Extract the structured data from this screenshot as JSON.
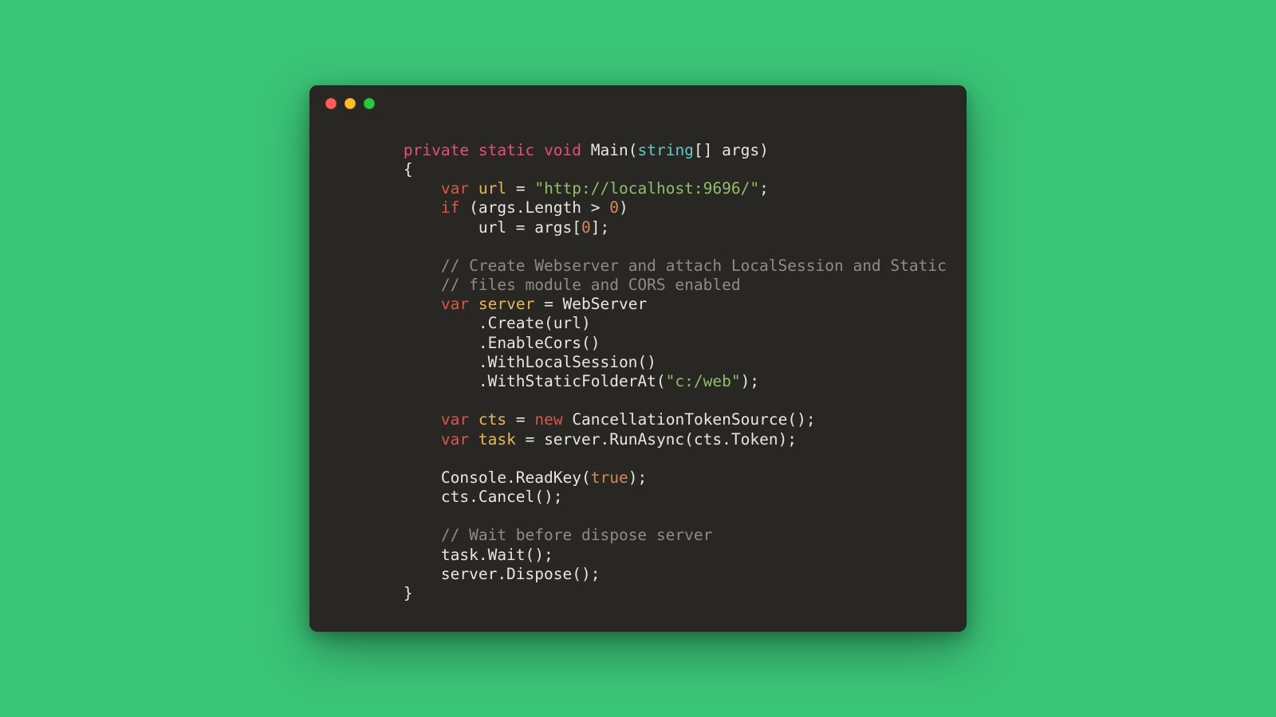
{
  "colors": {
    "background": "#3ac477",
    "window_bg": "#292724",
    "text": "#e8e6e1",
    "modifier": "#e64d80",
    "type": "#62c6c4",
    "decl": "#d9574b",
    "identifier": "#e7b85b",
    "string": "#8fbf6b",
    "number": "#d28a5a",
    "boolean": "#d28a5a",
    "comment": "#8f8c85",
    "traffic_close": "#ff5f56",
    "traffic_min": "#ffbd2e",
    "traffic_max": "#27c93f"
  },
  "window": {
    "traffic_lights": [
      "close",
      "minimize",
      "maximize"
    ]
  },
  "code": {
    "language": "csharp",
    "indent": "    ",
    "tokens": [
      [
        [
          "plain",
          "        "
        ],
        [
          "mod",
          "private"
        ],
        [
          "plain",
          " "
        ],
        [
          "mod",
          "static"
        ],
        [
          "plain",
          " "
        ],
        [
          "mod",
          "void"
        ],
        [
          "plain",
          " Main("
        ],
        [
          "type",
          "string"
        ],
        [
          "plain",
          "[] args)"
        ]
      ],
      [
        [
          "plain",
          "        {"
        ]
      ],
      [
        [
          "plain",
          "            "
        ],
        [
          "decl",
          "var"
        ],
        [
          "plain",
          " "
        ],
        [
          "name",
          "url"
        ],
        [
          "plain",
          " = "
        ],
        [
          "str",
          "\"http://localhost:9696/\""
        ],
        [
          "plain",
          ";"
        ]
      ],
      [
        [
          "plain",
          "            "
        ],
        [
          "decl",
          "if"
        ],
        [
          "plain",
          " (args.Length > "
        ],
        [
          "num",
          "0"
        ],
        [
          "plain",
          ")"
        ]
      ],
      [
        [
          "plain",
          "                url = args["
        ],
        [
          "num",
          "0"
        ],
        [
          "plain",
          "];"
        ]
      ],
      [
        [
          "plain",
          ""
        ]
      ],
      [
        [
          "plain",
          "            "
        ],
        [
          "cmt",
          "// Create Webserver and attach LocalSession and Static"
        ]
      ],
      [
        [
          "plain",
          "            "
        ],
        [
          "cmt",
          "// files module and CORS enabled"
        ]
      ],
      [
        [
          "plain",
          "            "
        ],
        [
          "decl",
          "var"
        ],
        [
          "plain",
          " "
        ],
        [
          "name",
          "server"
        ],
        [
          "plain",
          " = WebServer"
        ]
      ],
      [
        [
          "plain",
          "                .Create(url)"
        ]
      ],
      [
        [
          "plain",
          "                .EnableCors()"
        ]
      ],
      [
        [
          "plain",
          "                .WithLocalSession()"
        ]
      ],
      [
        [
          "plain",
          "                .WithStaticFolderAt("
        ],
        [
          "str",
          "\"c:/web\""
        ],
        [
          "plain",
          ");"
        ]
      ],
      [
        [
          "plain",
          ""
        ]
      ],
      [
        [
          "plain",
          "            "
        ],
        [
          "decl",
          "var"
        ],
        [
          "plain",
          " "
        ],
        [
          "name",
          "cts"
        ],
        [
          "plain",
          " = "
        ],
        [
          "decl",
          "new"
        ],
        [
          "plain",
          " CancellationTokenSource();"
        ]
      ],
      [
        [
          "plain",
          "            "
        ],
        [
          "decl",
          "var"
        ],
        [
          "plain",
          " "
        ],
        [
          "name",
          "task"
        ],
        [
          "plain",
          " = server.RunAsync(cts.Token);"
        ]
      ],
      [
        [
          "plain",
          ""
        ]
      ],
      [
        [
          "plain",
          "            Console.ReadKey("
        ],
        [
          "bool",
          "true"
        ],
        [
          "plain",
          ");"
        ]
      ],
      [
        [
          "plain",
          "            cts.Cancel();"
        ]
      ],
      [
        [
          "plain",
          ""
        ]
      ],
      [
        [
          "plain",
          "            "
        ],
        [
          "cmt",
          "// Wait before dispose server"
        ]
      ],
      [
        [
          "plain",
          "            task.Wait();"
        ]
      ],
      [
        [
          "plain",
          "            server.Dispose();"
        ]
      ],
      [
        [
          "plain",
          "        }"
        ]
      ]
    ]
  }
}
